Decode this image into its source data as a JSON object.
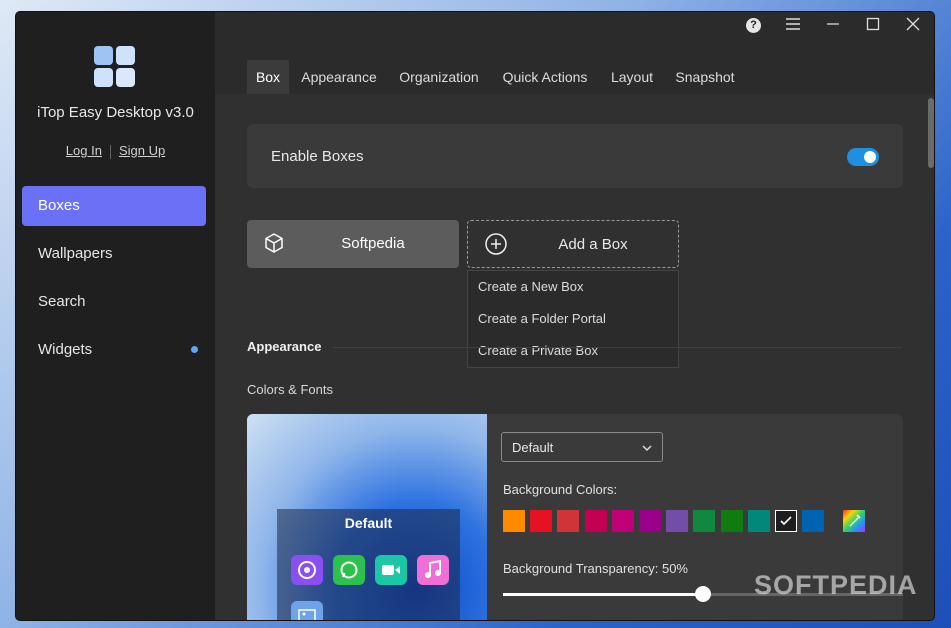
{
  "app": {
    "name": "iTop Easy Desktop v3.0",
    "login": "Log In",
    "signup": "Sign Up"
  },
  "sidebar": {
    "items": [
      {
        "label": "Boxes",
        "active": true
      },
      {
        "label": "Wallpapers"
      },
      {
        "label": "Search"
      },
      {
        "label": "Widgets",
        "dot": true
      }
    ]
  },
  "window": {
    "help_label": "?"
  },
  "tabs": [
    "Box",
    "Appearance",
    "Organization",
    "Quick Actions",
    "Layout",
    "Snapshot"
  ],
  "active_tab": "Box",
  "enable": {
    "label": "Enable Boxes",
    "on": true
  },
  "boxes": {
    "existing": "Softpedia",
    "add_label": "Add a Box",
    "menu": [
      "Create a New Box",
      "Create a Folder Portal",
      "Create a Private Box"
    ]
  },
  "appearance": {
    "section": "Appearance",
    "subsection": "Colors & Fonts",
    "preview_title": "Default",
    "theme_select": "Default",
    "bg_colors_label": "Background Colors:",
    "swatches": [
      "#ff8a00",
      "#e81123",
      "#d13438",
      "#c30052",
      "#bf0077",
      "#9a0089",
      "#744da9",
      "#10893e",
      "#107c10",
      "#00897b",
      "#1e1e1e",
      "#0063b1"
    ],
    "selected_swatch": 10,
    "transparency_label": "Background Transparency: 50%",
    "transparency": 0.5
  },
  "watermark": "SOFTPEDIA",
  "colors": {
    "accent": "#6b71f7",
    "toggle": "#1f8fe0"
  }
}
